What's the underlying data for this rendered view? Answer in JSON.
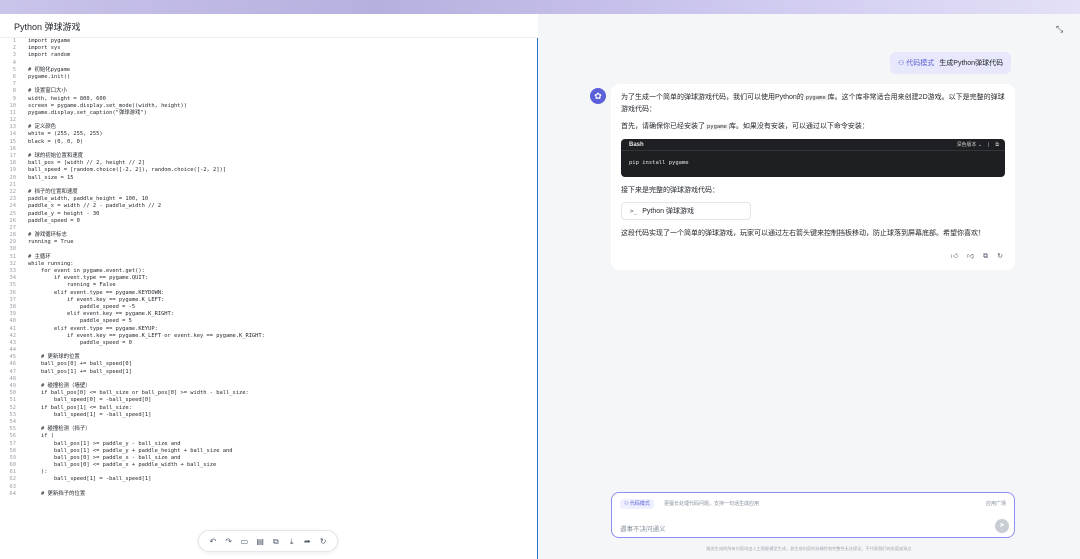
{
  "left_panel": {
    "title": "Python 弹球游戏",
    "code_lines": [
      "import pygame",
      "import sys",
      "import random",
      "",
      "# 初始化pygame",
      "pygame.init()",
      "",
      "# 设置窗口大小",
      "width, height = 800, 600",
      "screen = pygame.display.set_mode((width, height))",
      "pygame.display.set_caption(\"弹球游戏\")",
      "",
      "# 定义颜色",
      "white = (255, 255, 255)",
      "black = (0, 0, 0)",
      "",
      "# 球的初始位置和速度",
      "ball_pos = [width // 2, height // 2]",
      "ball_speed = [random.choice([-2, 2]), random.choice([-2, 2])]",
      "ball_size = 15",
      "",
      "# 挡子的位置和速度",
      "paddle_width, paddle_height = 100, 10",
      "paddle_x = width // 2 - paddle_width // 2",
      "paddle_y = height - 30",
      "paddle_speed = 0",
      "",
      "# 游戏循环标志",
      "running = True",
      "",
      "# 主循环",
      "while running:",
      "    for event in pygame.event.get():",
      "        if event.type == pygame.QUIT:",
      "            running = False",
      "        elif event.type == pygame.KEYDOWN:",
      "            if event.key == pygame.K_LEFT:",
      "                paddle_speed = -5",
      "            elif event.key == pygame.K_RIGHT:",
      "                paddle_speed = 5",
      "        elif event.type == pygame.KEYUP:",
      "            if event.key == pygame.K_LEFT or event.key == pygame.K_RIGHT:",
      "                paddle_speed = 0",
      "",
      "    # 更新球的位置",
      "    ball_pos[0] += ball_speed[0]",
      "    ball_pos[1] += ball_speed[1]",
      "",
      "    # 碰撞检测（墙壁）",
      "    if ball_pos[0] <= ball_size or ball_pos[0] >= width - ball_size:",
      "        ball_speed[0] = -ball_speed[0]",
      "    if ball_pos[1] <= ball_size:",
      "        ball_speed[1] = -ball_speed[1]",
      "",
      "    # 碰撞检测（挡子）",
      "    if (",
      "        ball_pos[1] >= paddle_y - ball_size and",
      "        ball_pos[1] <= paddle_y + paddle_height + ball_size and",
      "        ball_pos[0] >= paddle_x - ball_size and",
      "        ball_pos[0] <= paddle_x + paddle_width + ball_size",
      "    ):",
      "        ball_speed[1] = -ball_speed[1]",
      "",
      "    # 更新挡子的位置"
    ],
    "toolbar_icons": [
      "undo-icon",
      "redo-icon",
      "comment-icon",
      "document-icon",
      "copy-icon",
      "download-icon",
      "share-icon",
      "refresh-icon"
    ]
  },
  "right_panel": {
    "user_message": {
      "mode_label": "代码模式",
      "text": "生成Python弹球代码"
    },
    "ai_message": {
      "para1_a": "为了生成一个简单的弹球游戏代码，我们可以使用Python的",
      "para1_code": "pygame",
      "para1_b": "库。这个库非常适合用来创建2D游戏。以下是完整的弹球游戏代码：",
      "para2_a": "首先，请确保你已经安装了",
      "para2_code": "pygame",
      "para2_b": "库。如果没有安装，可以通过以下命令安装：",
      "code_block": {
        "language": "Bash",
        "theme_label": "深色版本",
        "code": "pip install pygame"
      },
      "para3": "接下来是完整的弹球游戏代码：",
      "file_card_icon": ">_",
      "file_card_label": "Python 弹球游戏",
      "para4": "这段代码实现了一个简单的弹球游戏，玩家可以通过左右箭头键来控制挡板移动，防止球落到屏幕底部。希望你喜欢！"
    },
    "input": {
      "mode_label": "代码模式",
      "hint": "更擅长处理代码问题，支持一句话生成应用",
      "square_label": "应用广场",
      "placeholder": "遇事不决问通义"
    },
    "disclaimer": "服务生成的所有内容均由人工智能模型生成，其生成内容的准确性和完整性无法保证，不代表我们的态度或观点"
  }
}
